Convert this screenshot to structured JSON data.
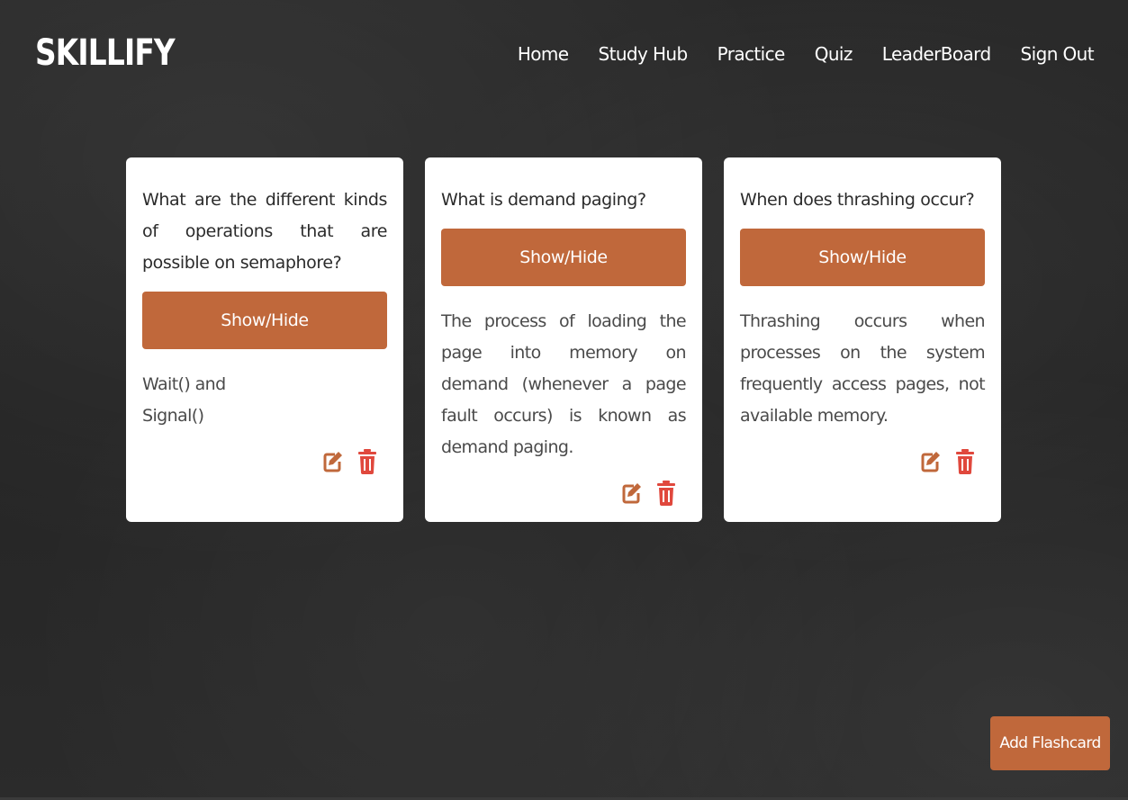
{
  "header": {
    "brand": "SKILLIFY",
    "nav": [
      "Home",
      "Study Hub",
      "Practice",
      "Quiz",
      "LeaderBoard",
      "Sign Out"
    ]
  },
  "cards": [
    {
      "question": "What are the different kinds of operations that are possible on semaphore?",
      "toggle_label": "Show/Hide",
      "answer": "Wait() and\nSignal()",
      "edit_icon": "edit-icon",
      "delete_icon": "trash-icon"
    },
    {
      "question": "What is demand paging?",
      "toggle_label": "Show/Hide",
      "answer": "The process of loading the page into memory on demand (whenever a page fault occurs) is known as demand paging.",
      "edit_icon": "edit-icon",
      "delete_icon": "trash-icon"
    },
    {
      "question": "When does thrashing occur?",
      "toggle_label": "Show/Hide",
      "answer": "Thrashing occurs when processes on the system frequently access pages, not available memory.",
      "edit_icon": "edit-icon",
      "delete_icon": "trash-icon"
    }
  ],
  "add_button_label": "Add Flashcard",
  "colors": {
    "accent": "#c0683b",
    "edit_icon": "#c0683b",
    "delete_icon": "#e0483d",
    "card_bg": "#ffffff",
    "page_bg": "#262626"
  }
}
